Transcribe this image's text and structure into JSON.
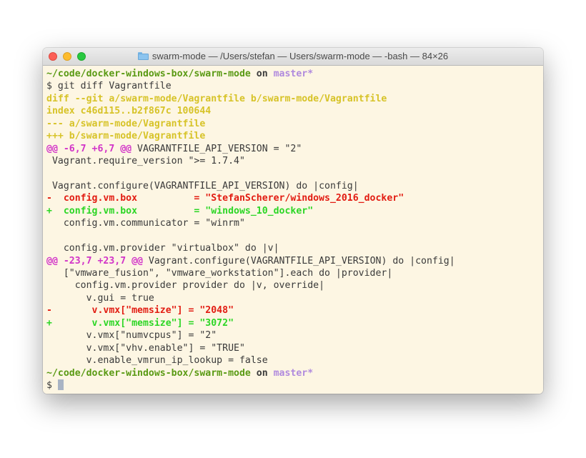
{
  "window": {
    "title": "swarm-mode — /Users/stefan — Users/swarm-mode — -bash — 84×26",
    "folder_icon": "folder-icon"
  },
  "colors": {
    "background": "#fdf6e3",
    "prompt_path": "#5a9a14",
    "branch": "#b08ade",
    "diff_meta": "#d7c328",
    "hunk_header": "#d233c8",
    "removed": "#e21c12",
    "added": "#2cd625",
    "text": "#3a3a3a"
  },
  "prompt1": {
    "path": "~/code/docker-windows-box/swarm-mode",
    "on": " on ",
    "branch": "master*"
  },
  "command": "$ git diff Vagrantfile",
  "diff_header": [
    "diff --git a/swarm-mode/Vagrantfile b/swarm-mode/Vagrantfile",
    "index c46d115..b2f867c 100644",
    "--- a/swarm-mode/Vagrantfile",
    "+++ b/swarm-mode/Vagrantfile"
  ],
  "hunk1": {
    "marker": "@@ -6,7 +6,7 @@",
    "context": " VAGRANTFILE_API_VERSION = \"2\""
  },
  "ctx1": [
    " Vagrant.require_version \">= 1.7.4\"",
    "",
    " Vagrant.configure(VAGRANTFILE_API_VERSION) do |config|"
  ],
  "removed1": "-  config.vm.box          = \"StefanScherer/windows_2016_docker\"",
  "added1": "+  config.vm.box          = \"windows_10_docker\"",
  "ctx2": [
    "   config.vm.communicator = \"winrm\"",
    "",
    "   config.vm.provider \"virtualbox\" do |v|"
  ],
  "hunk2": {
    "marker": "@@ -23,7 +23,7 @@",
    "context": " Vagrant.configure(VAGRANTFILE_API_VERSION) do |config|"
  },
  "ctx3": [
    "   [\"vmware_fusion\", \"vmware_workstation\"].each do |provider|",
    "     config.vm.provider provider do |v, override|",
    "       v.gui = true"
  ],
  "removed2": "-       v.vmx[\"memsize\"] = \"2048\"",
  "added2": "+       v.vmx[\"memsize\"] = \"3072\"",
  "ctx4": [
    "       v.vmx[\"numvcpus\"] = \"2\"",
    "       v.vmx[\"vhv.enable\"] = \"TRUE\"",
    "       v.enable_vmrun_ip_lookup = false"
  ],
  "prompt2": {
    "path": "~/code/docker-windows-box/swarm-mode",
    "on": " on ",
    "branch": "master*"
  },
  "input_prompt": "$ "
}
